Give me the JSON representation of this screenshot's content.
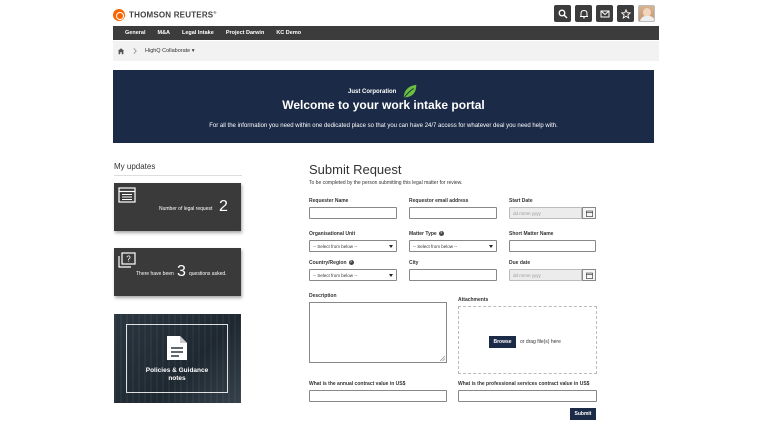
{
  "header": {
    "brand": "THOMSON REUTERS",
    "brand_mark": "®",
    "icons": [
      "search-icon",
      "bell-icon",
      "mail-icon",
      "star-icon"
    ]
  },
  "nav": {
    "items": [
      "General",
      "M&A",
      "Legal Intake",
      "Project Darwin",
      "KC Demo"
    ]
  },
  "breadcrumb": {
    "current": "HighQ Collaborate ▾"
  },
  "banner": {
    "company": "Just Corporation",
    "title": "Welcome to your work intake portal",
    "subtitle": "For all the information you need within one dedicated place so that you can have 24/7 access for whatever deal you need help with."
  },
  "updates": {
    "title": "My updates",
    "legal_requests_label": "Number of legal request",
    "legal_requests_count": "2",
    "questions_prefix": "There have been",
    "questions_count": "3",
    "questions_suffix": "questions asked.",
    "policies_line1": "Policies & Guidance",
    "policies_line2": "notes"
  },
  "form": {
    "title": "Submit Request",
    "subtitle": "To be completed by the person submitting this legal matter for review.",
    "requester_name_label": "Requester Name",
    "requester_email_label": "Requestor email address",
    "start_date_label": "Start Date",
    "date_placeholder": "dd mmm yyyy",
    "org_unit_label": "Organisational Unit",
    "matter_type_label": "Matter Type",
    "short_matter_label": "Short Matter Name",
    "select_placeholder": "-- Select from below --",
    "country_label": "Country/Region",
    "city_label": "City",
    "due_date_label": "Due date",
    "description_label": "Description",
    "attachments_label": "Attachments",
    "browse_label": "Browse",
    "drag_text": "or drag file(s) here",
    "annual_value_label": "What is the annual contract value in US$",
    "services_value_label": "What is the professional services contract value in US$",
    "submit_label": "Submit"
  }
}
